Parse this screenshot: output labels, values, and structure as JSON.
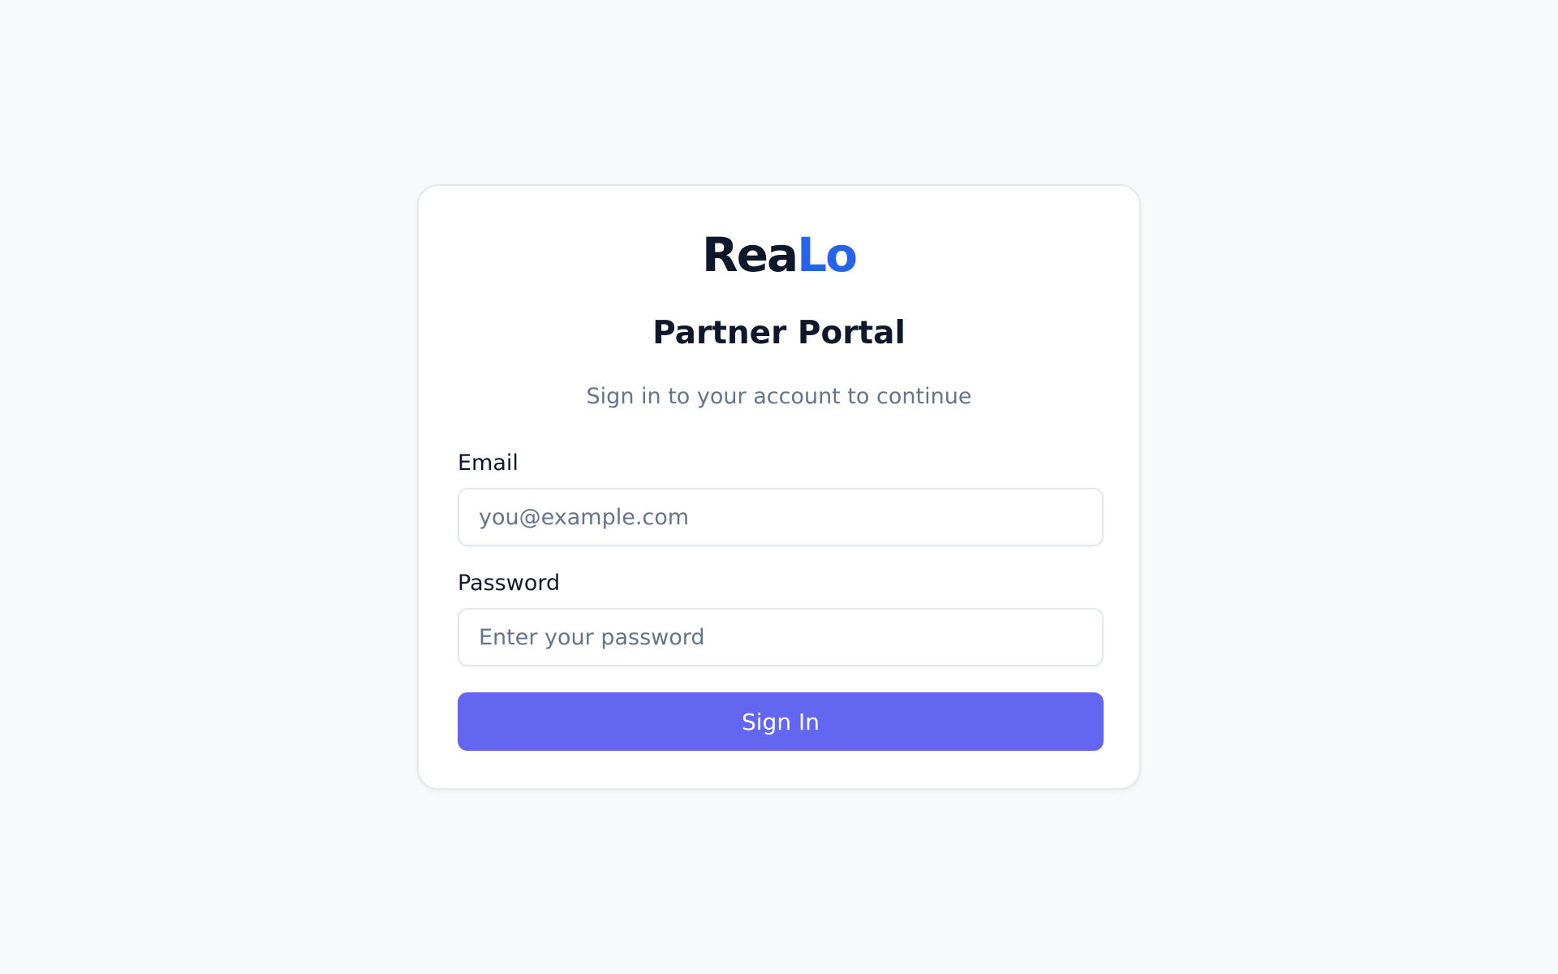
{
  "brand": {
    "name_part1": "Rea",
    "name_part2": "Lo"
  },
  "heading": {
    "title": "Partner Portal",
    "subtitle": "Sign in to your account to continue"
  },
  "form": {
    "email": {
      "label": "Email",
      "value": "",
      "placeholder": "you@example.com"
    },
    "password": {
      "label": "Password",
      "value": "",
      "placeholder": "Enter your password"
    },
    "submit_label": "Sign In"
  },
  "colors": {
    "background": "#f8f9fb",
    "brand_dark": "#0f172a",
    "brand_accent": "#2563eb",
    "button": "#6366f1",
    "muted_text": "#64748b"
  }
}
